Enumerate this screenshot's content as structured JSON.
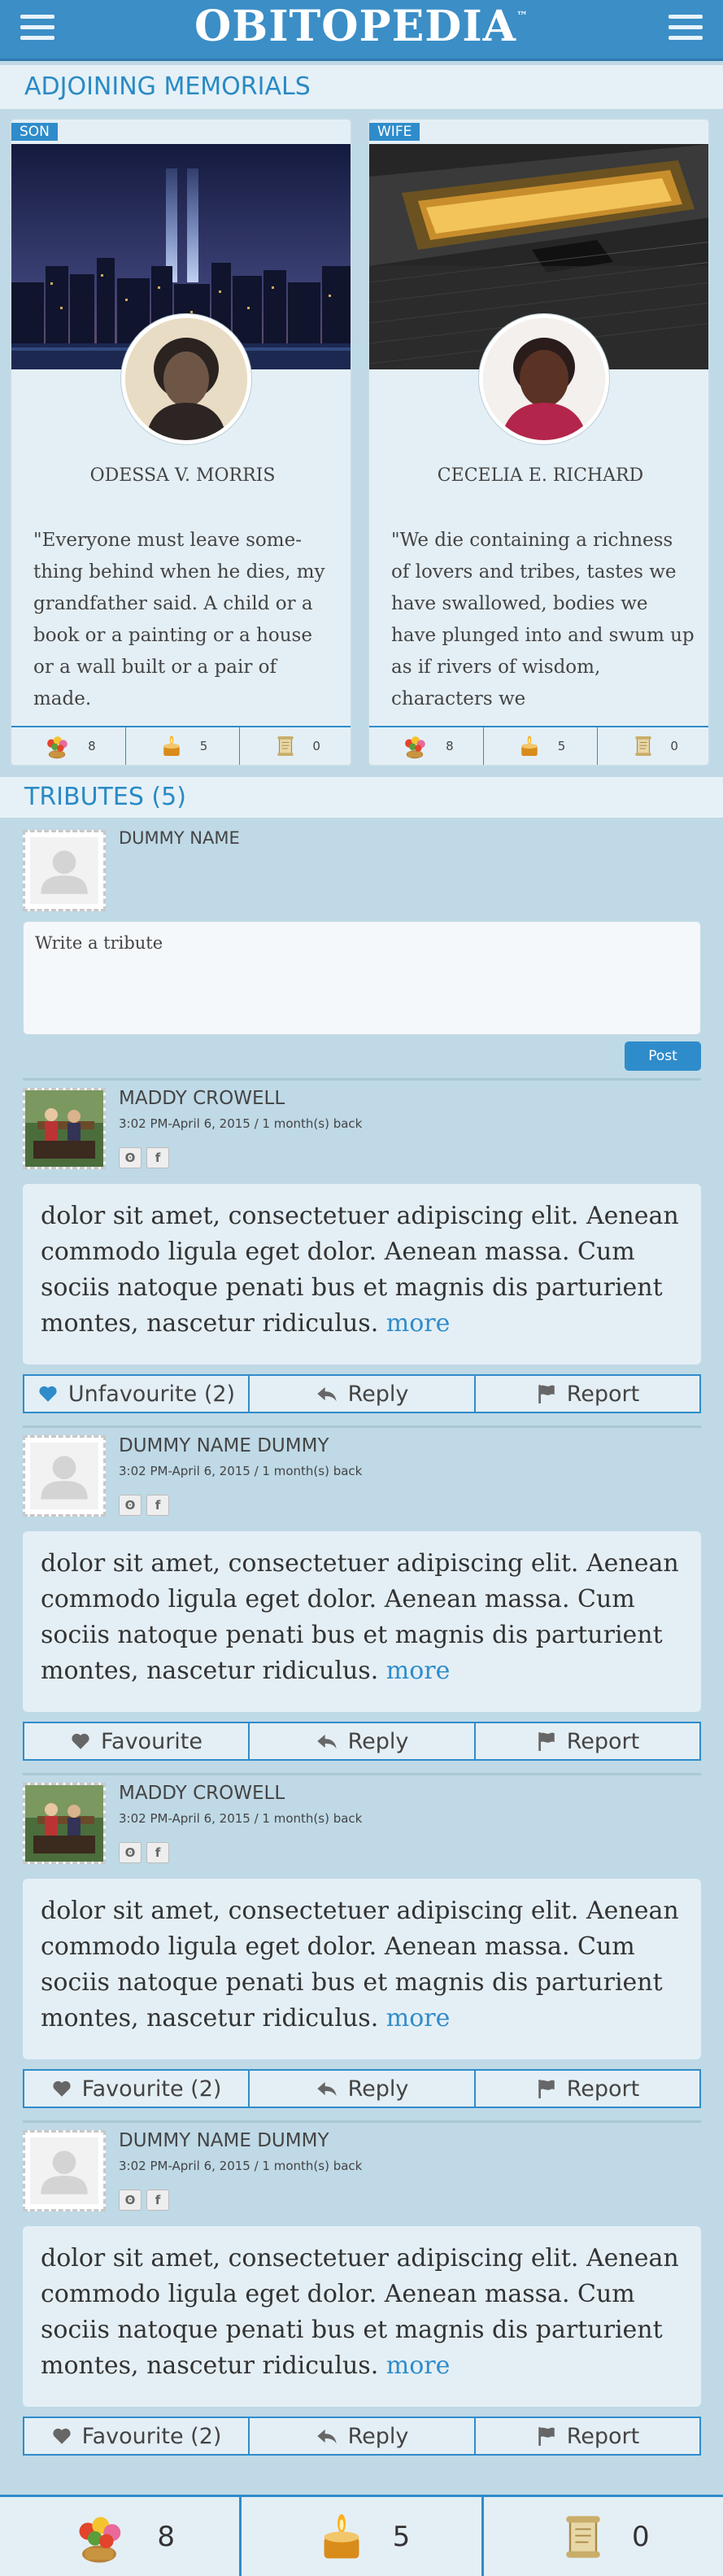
{
  "header": {
    "brand": "OBITOPEDIA",
    "trademark": "™"
  },
  "adjoining": {
    "title": "ADJOINING MEMORIALS",
    "cards": [
      {
        "relation": "SON",
        "name": "ODESSA V. MORRIS",
        "quote": "\"Everyone must leave some-thing behind when he dies, my grandfather said. A child or a book or a painting or a house or a wall built or a pair of made.",
        "stats": {
          "flowers": "8",
          "candles": "5",
          "scrolls": "0"
        }
      },
      {
        "relation": "WIFE",
        "name": "CECELIA E. RICHARD",
        "quote": "\"We die containing a richness of lovers and tribes, tastes we have swallowed, bodies we have plunged into and swum up as if rivers of wisdom, characters we",
        "stats": {
          "flowers": "8",
          "candles": "5",
          "scrolls": "0"
        }
      }
    ]
  },
  "tributes": {
    "title": "TRIBUTES (5)",
    "composer": {
      "name": "DUMMY NAME",
      "placeholder": "Write a tribute",
      "post_label": "Post"
    },
    "items": [
      {
        "name": "MADDY CROWELL",
        "time": "3:02 PM-April 6, 2015 / 1 month(s) back",
        "body": "dolor sit amet, consectetuer adipiscing elit. Aenean commodo ligula eget dolor. Aenean massa. Cum sociis natoque penati bus et magnis dis parturient montes, nascetur ridiculus.",
        "more": "more",
        "favourite": "Unfavourite (2)",
        "reply": "Reply",
        "report": "Report"
      },
      {
        "name": "DUMMY NAME DUMMY",
        "time": "3:02 PM-April 6, 2015 / 1 month(s) back",
        "body": "dolor sit amet, consectetuer adipiscing elit. Aenean commodo ligula eget dolor. Aenean massa. Cum sociis natoque penati bus et magnis dis parturient montes, nascetur ridiculus.",
        "more": "more",
        "favourite": "Favourite",
        "reply": "Reply",
        "report": "Report"
      },
      {
        "name": "MADDY CROWELL",
        "time": "3:02 PM-April 6, 2015 / 1 month(s) back",
        "body": "dolor sit amet, consectetuer adipiscing elit. Aenean commodo ligula eget dolor. Aenean massa. Cum sociis natoque penati bus et magnis dis parturient montes, nascetur ridiculus.",
        "more": "more",
        "favourite": "Favourite (2)",
        "reply": "Reply",
        "report": "Report"
      },
      {
        "name": "DUMMY NAME DUMMY",
        "time": "3:02 PM-April 6, 2015 / 1 month(s) back",
        "body": "dolor sit amet, consectetuer adipiscing elit. Aenean commodo ligula eget dolor. Aenean massa. Cum sociis natoque penati bus et magnis dis parturient montes, nascetur ridiculus.",
        "more": "more",
        "favourite": "Favourite (2)",
        "reply": "Reply",
        "report": "Report"
      }
    ]
  },
  "social": {
    "orkut": "ʘ",
    "facebook": "f"
  },
  "footer": {
    "flowers": "8",
    "candles": "5",
    "scrolls": "0"
  },
  "colors": {
    "primary": "#3b8ec6",
    "accent": "#2f8ccb",
    "page_bg": "#bfd9e6",
    "card_bg": "#e4eff5"
  }
}
